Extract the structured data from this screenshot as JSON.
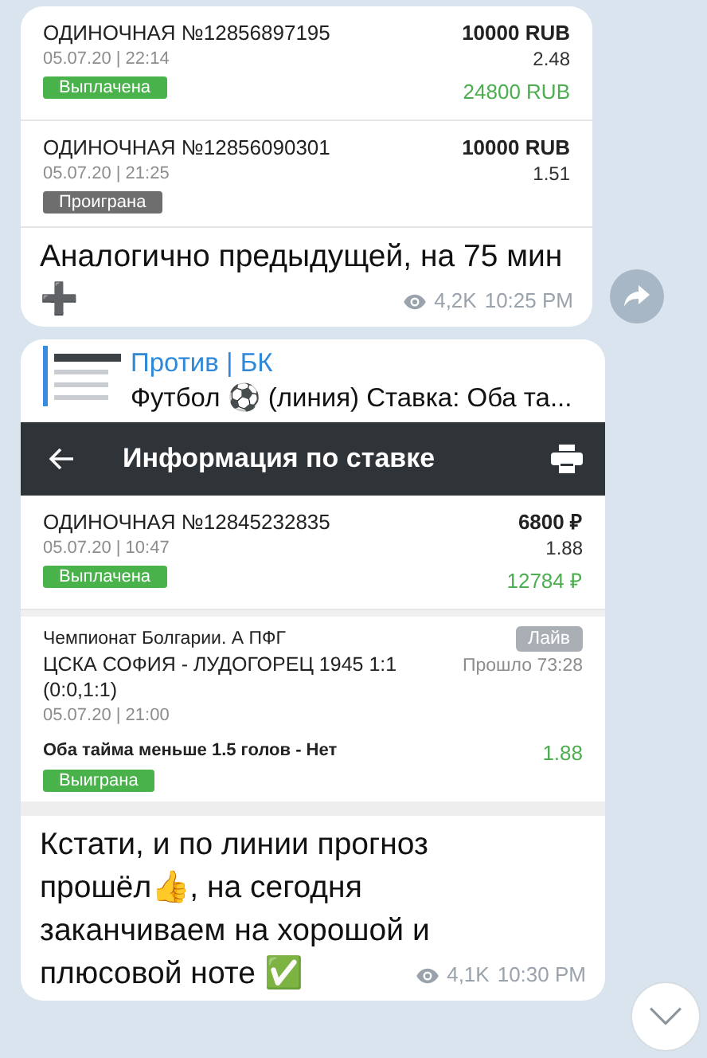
{
  "messages": [
    {
      "kind": "bets",
      "bets": [
        {
          "title": "ОДИНОЧНАЯ №12856897195",
          "date": "05.07.20 | 22:14",
          "stake": "10000 RUB",
          "odds": "2.48",
          "status": "Выплачена",
          "color": "#49b24b",
          "payout": "24800 RUB"
        },
        {
          "title": "ОДИНОЧНАЯ №12856090301",
          "date": "05.07.20 | 21:25",
          "stake": "10000 RUB",
          "odds": "1.51",
          "status": "Проиграна",
          "color": "#6e6e6e"
        }
      ],
      "text": "Аналогично предыдущей, на 75 мин ➕",
      "views": "4,2K",
      "time": "10:25 PM",
      "forward": true
    },
    {
      "kind": "reply",
      "reply": {
        "author": "Против | БК",
        "preview": "Футбол ⚽ (линия) Ставка: Оба та..."
      },
      "header": "Информация по ставке",
      "bets": [
        {
          "title": "ОДИНОЧНАЯ №12845232835",
          "date": "05.07.20 | 10:47",
          "stake": "6800 ₽",
          "odds": "1.88",
          "status": "Выплачена",
          "color": "#49b24b",
          "payout": "12784 ₽"
        }
      ],
      "event": {
        "league": "Чемпионат Болгарии. А ПФГ",
        "match": "ЦСКА СОФИЯ - ЛУДОГОРЕЦ 1945 1:1 (0:0,1:1)",
        "date": "05.07.20 | 21:00",
        "badge": "Лайв",
        "elapsed": "Прошло 73:28",
        "market": "Оба тайма меньше 1.5 голов - Нет",
        "odds": "1.88",
        "status": "Выиграна",
        "color": "#49b24b"
      },
      "text": "Кстати, и по линии прогноз прошёл👍, на сегодня заканчиваем на хорошой и плюсовой ноте ✅",
      "views": "4,1K",
      "time": "10:30 PM"
    }
  ]
}
